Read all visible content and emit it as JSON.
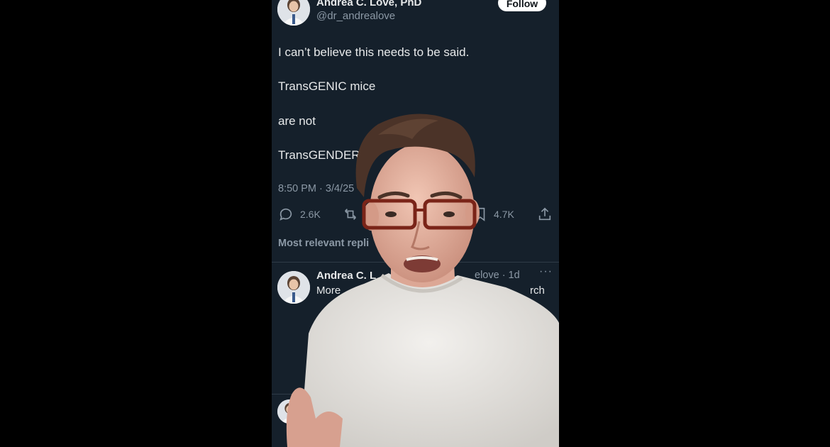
{
  "post": {
    "author_name": "Andrea C. Love, PhD",
    "author_handle": "@dr_andrealove",
    "follow_label": "Follow",
    "lines": [
      "I can’t believe this needs to be said.",
      "TransGENIC mice",
      "are not",
      "TransGENDER"
    ],
    "timestamp": "8:50 PM · 3/4/25",
    "replies_count": "2.6K",
    "bookmarks_count": "4.7K"
  },
  "replies_section": {
    "label": "Most relevant repli"
  },
  "reply": {
    "author_name": "Andrea C. L",
    "meta": "elove · 1d",
    "more": "···",
    "text_start": "More",
    "text_end": "rch"
  },
  "colors": {
    "background": "#15202b",
    "text": "#e7e9ea",
    "muted": "#8b98a5",
    "follow_bg": "#ffffff"
  },
  "icons": {
    "reply": "speech-bubble-icon",
    "retweet": "retweet-icon",
    "bookmark": "bookmark-icon",
    "share": "share-icon",
    "more": "more-dots-icon"
  }
}
